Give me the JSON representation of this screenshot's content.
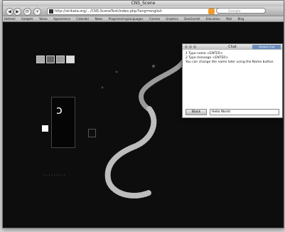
{
  "window": {
    "title": "CNS_Scene"
  },
  "toolbar": {
    "back": "◀",
    "forward": "▶",
    "reload": "⟳",
    "add": "+",
    "url": "http://sirikata.org/.../CNS-SceneTest/index.php?lang=english",
    "search_placeholder": "Google"
  },
  "bookmarks": [
    "Hotmail",
    "Gadgets",
    "Yahoo",
    "Appearance",
    "Calendar",
    "News",
    "ProgrammingLanguages",
    "Cinema",
    "Graphics",
    "DanGarrett",
    "Education",
    "Mail",
    "Blog"
  ],
  "content": {
    "decor_label": "·········"
  },
  "chat": {
    "title": "Chat",
    "badge": "Sirikata Chat",
    "line1": "1  Type name <ENTER>",
    "line2": "2  Type message <ENTER>",
    "line3": "You can change the name later using the Name button.",
    "name_button": "Black",
    "input_value": "Hello World"
  }
}
